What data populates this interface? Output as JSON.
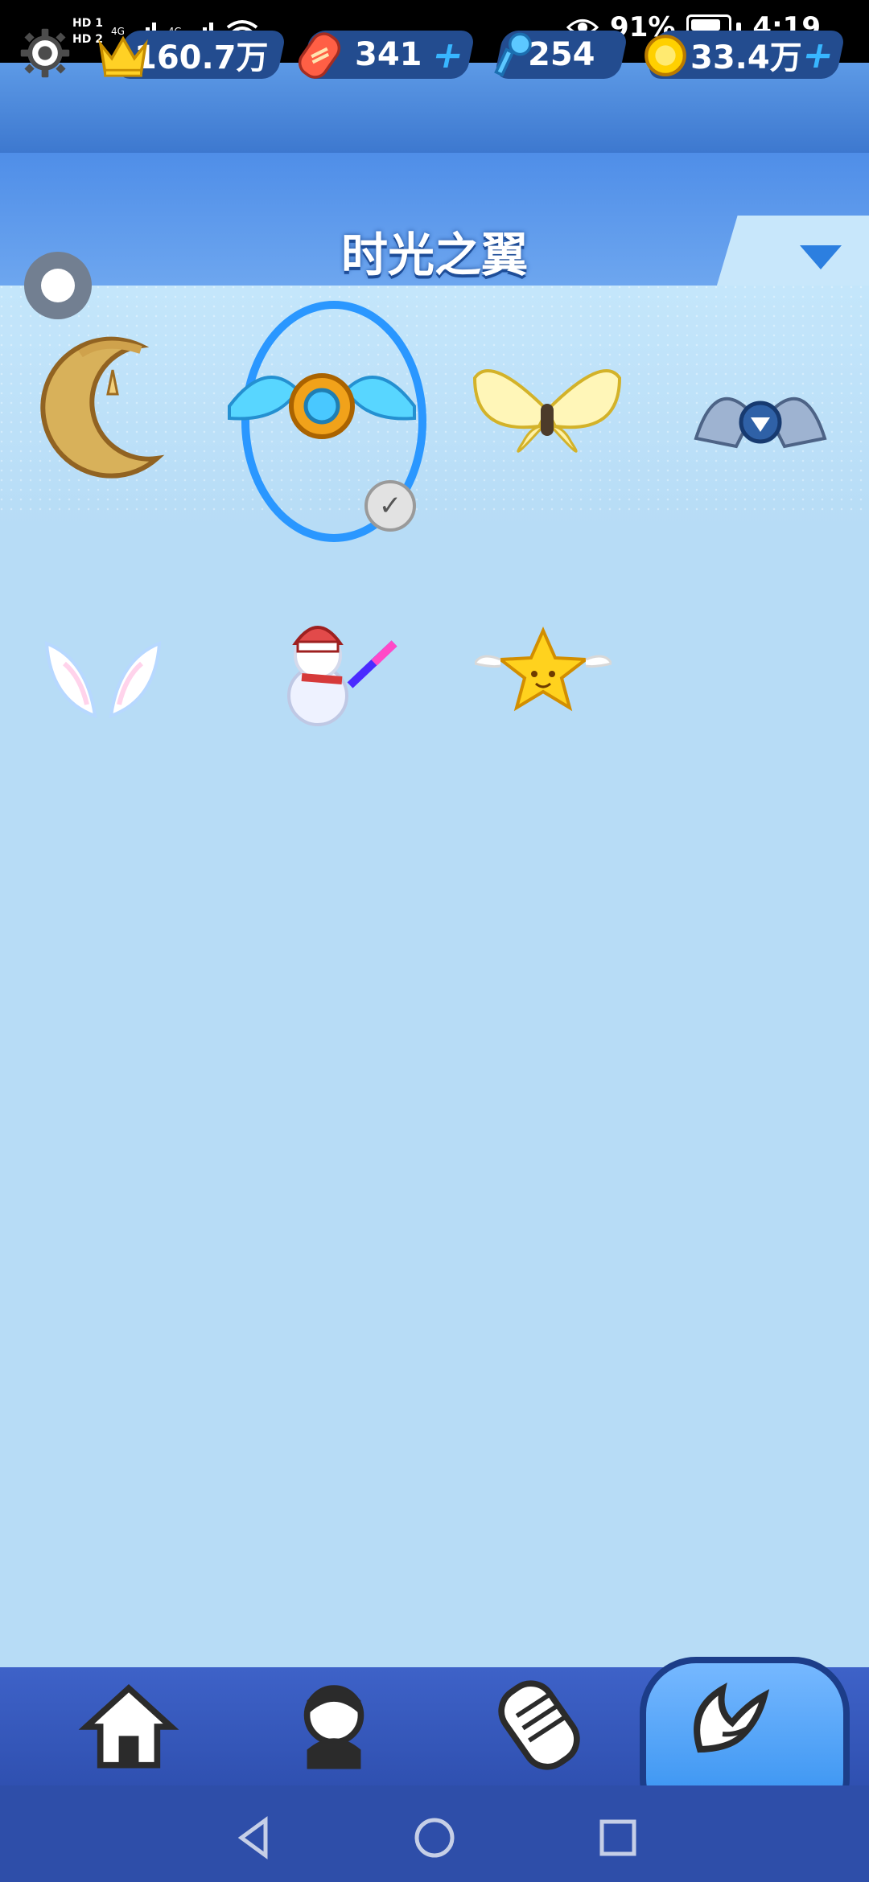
{
  "status_bar": {
    "signal_labels": [
      "HD 1",
      "HD 2"
    ],
    "network": [
      "4G",
      "4G"
    ],
    "battery": "91%",
    "time": "4:19"
  },
  "top_bar": {
    "crown_value": "160.7万",
    "board_value": "341",
    "key_value": "254",
    "coin_value": "33.4万"
  },
  "page": {
    "title": "时光之翼"
  },
  "bottom_nav": {
    "items": [
      {
        "label": "菜单"
      },
      {
        "label": "角色"
      },
      {
        "label": "滑板"
      },
      {
        "label": "背饰"
      }
    ]
  }
}
